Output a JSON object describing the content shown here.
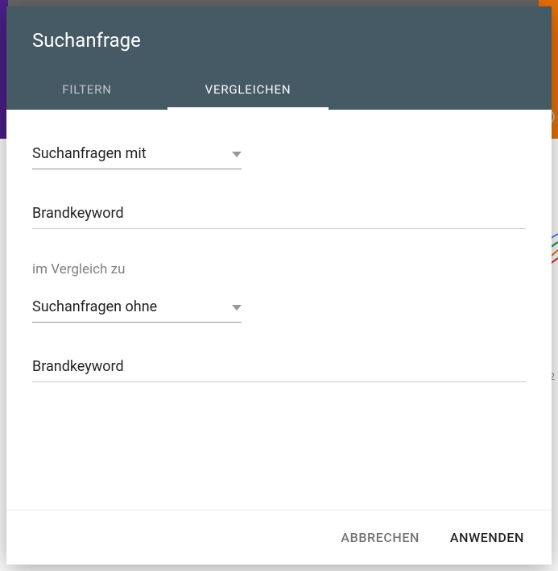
{
  "dialog": {
    "title": "Suchanfrage",
    "tabs": {
      "filter": "FILTERN",
      "compare": "VERGLEICHEN"
    },
    "select1": "Suchanfragen mit",
    "input1": "Brandkeyword",
    "compareLabel": "im Vergleich zu",
    "select2": "Suchanfragen ohne",
    "input2": "Brandkeyword",
    "cancel": "ABBRECHEN",
    "apply": "ANWENDEN"
  },
  "background": {
    "axisFragment": ".2"
  }
}
